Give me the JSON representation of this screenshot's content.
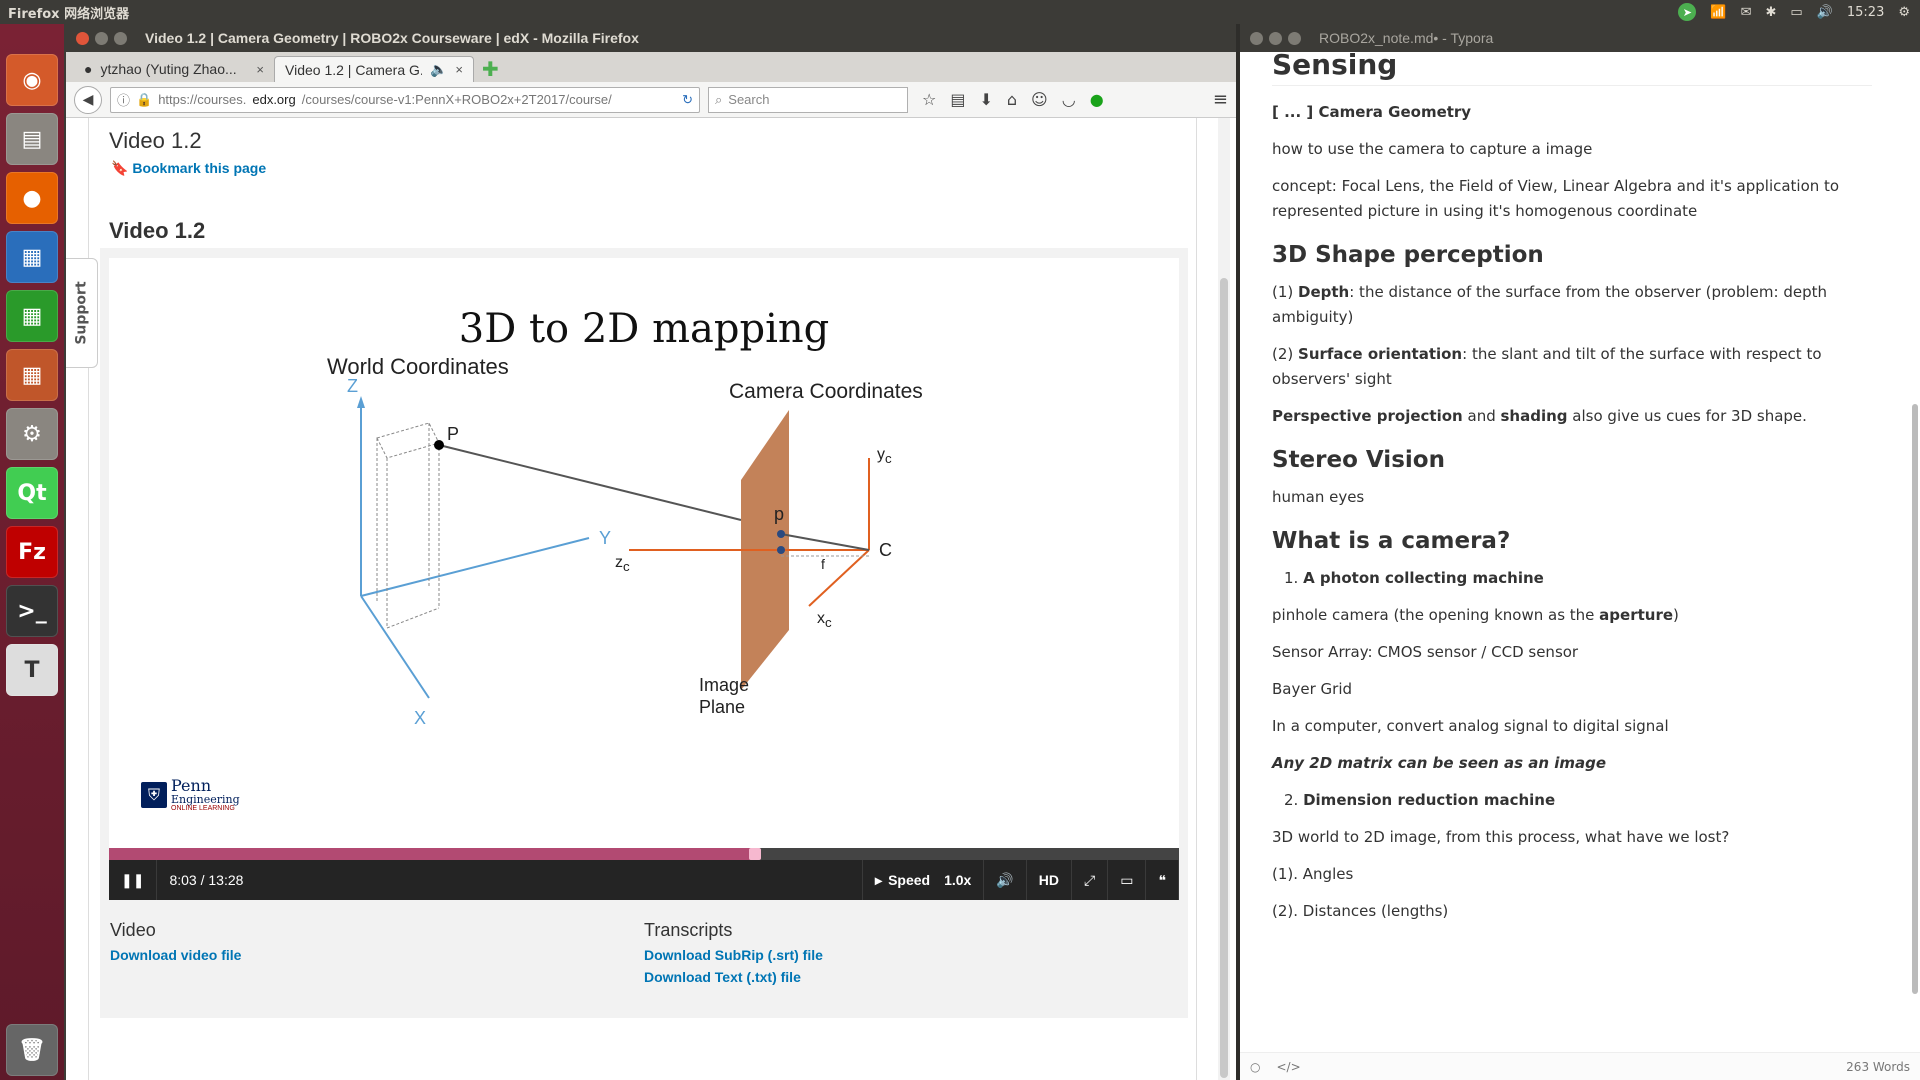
{
  "top_panel": {
    "app_name": "Firefox 网络浏览器",
    "clock": "15:23"
  },
  "launcher": {
    "items": [
      {
        "name": "ubuntu-dash-icon",
        "label": "◉",
        "color": "#d45a2a"
      },
      {
        "name": "files-icon",
        "label": "▤",
        "color": "#8a8680"
      },
      {
        "name": "firefox-icon",
        "label": "●",
        "color": "#e66000"
      },
      {
        "name": "writer-icon",
        "label": "▦",
        "color": "#2a6ebb"
      },
      {
        "name": "calc-icon",
        "label": "▦",
        "color": "#2a9a2a"
      },
      {
        "name": "impress-icon",
        "label": "▦",
        "color": "#c0562a"
      },
      {
        "name": "settings-icon",
        "label": "⚙",
        "color": "#8a8680"
      },
      {
        "name": "qt-icon",
        "label": "Qt",
        "color": "#41cd52"
      },
      {
        "name": "filezilla-icon",
        "label": "Fz",
        "color": "#bf0000"
      },
      {
        "name": "terminal-icon",
        "label": ">_",
        "color": "#333"
      },
      {
        "name": "typora-icon",
        "label": "T",
        "color": "#ddd"
      },
      {
        "name": "trash-icon",
        "label": "🗑",
        "color": "#666"
      }
    ]
  },
  "firefox": {
    "window_title": "Video 1.2 | Camera Geometry | ROBO2x Courseware | edX - Mozilla Firefox",
    "tabs": [
      {
        "label": "ytzhao (Yuting Zhao...",
        "close": "×"
      },
      {
        "label": "Video 1.2 | Camera G...",
        "close": "×"
      }
    ],
    "tab_add": "✚",
    "url_prefix": "https://courses.",
    "url_domain": "edx.org",
    "url_rest": "/courses/course-v1:PennX+ROBO2x+2T2017/course/",
    "search_placeholder": "Search",
    "support_tab": "Support"
  },
  "page": {
    "heading": "Video 1.2",
    "bookmark": "Bookmark this page",
    "video_heading": "Video 1.2",
    "slide": {
      "title": "3D to 2D mapping",
      "world_coordinates": "World Coordinates",
      "camera_coordinates": "Camera Coordinates",
      "axis_z": "Z",
      "axis_y": "Y",
      "axis_x": "X",
      "point_P": "P",
      "point_p": "p",
      "point_C": "C",
      "focal_f": "f",
      "image_plane_line1": "Image",
      "image_plane_line2": "Plane",
      "yc": "y",
      "zc": "z",
      "xc": "x",
      "sub_c": "c",
      "penn_name": "Penn",
      "penn_eng": "Engineering",
      "penn_sub": "ONLINE LEARNING"
    },
    "player": {
      "progress": 0.6041,
      "time": "8:03 / 13:28",
      "speed_label": "Speed",
      "speed_value": "1.0x",
      "hd": "HD",
      "colors": {
        "progress": "#b24a72",
        "handle": "#f6b8cf"
      }
    },
    "downloads": {
      "video_title": "Video",
      "video_link": "Download video file",
      "transcripts_title": "Transcripts",
      "srt_link": "Download SubRip (.srt) file",
      "txt_link": "Download Text (.txt) file"
    }
  },
  "typora": {
    "window_title": "ROBO2x_note.md• - Typora",
    "word_count": "263 Words",
    "doc": {
      "h1": "Sensing",
      "camera_geometry": "[ ... ] Camera Geometry",
      "p1": "how to use the camera to capture a image",
      "p2": "concept: Focal Lens, the Field of View, Linear Algebra and it's application to represented picture in using it's homogenous coordinate",
      "h2_shape": "3D Shape perception",
      "depth_prefix": "(1) ",
      "depth_bold": "Depth",
      "depth_rest": ": the distance of the surface from the observer (problem: depth ambiguity)",
      "orient_prefix": "(2) ",
      "orient_bold": "Surface orientation",
      "orient_rest": ": the slant and tilt of the surface with respect to observers' sight",
      "persp_bold": "Perspective projection",
      "persp_mid": " and ",
      "shading_bold": "shading",
      "persp_rest": " also give us cues for 3D shape.",
      "h2_stereo": "Stereo Vision",
      "human_eyes": "human eyes",
      "h2_camera": "What is a camera?",
      "li1_num": "1. ",
      "li1": "A photon collecting machine",
      "pinhole_pre": "pinhole camera  (the opening known as the ",
      "pinhole_bold": "aperture",
      "pinhole_post": ")",
      "sensor": "Sensor Array: CMOS sensor / CCD sensor",
      "bayer": "Bayer Grid",
      "analog": "In a computer, convert analog signal to digital signal",
      "matrix": "Any 2D matrix can be seen as an image",
      "li2_num": "2. ",
      "li2": "Dimension reduction machine",
      "lost": "3D world to 2D image, from this process, what have we lost?",
      "angles": "(1). Angles",
      "distances": "(2). Distances  (lengths)"
    }
  }
}
